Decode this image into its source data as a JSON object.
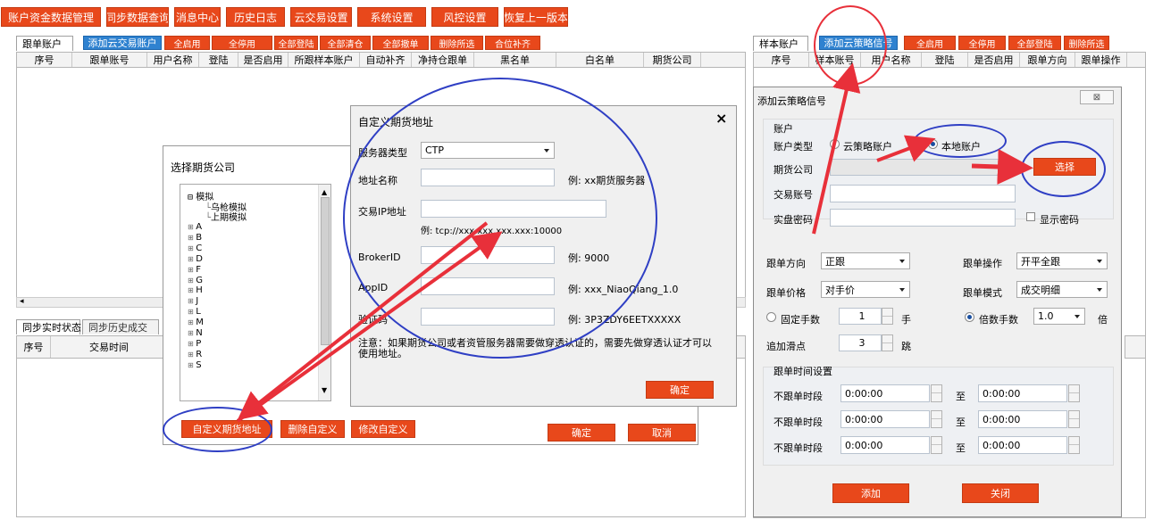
{
  "top_menu": [
    "账户资金数据管理",
    "同步数据查询",
    "消息中心",
    "历史日志",
    "云交易设置",
    "系统设置",
    "风控设置",
    "恢复上一版本"
  ],
  "left_tab": {
    "label": "跟单账户",
    "buttons_blue": "添加云交易账户",
    "buttons": [
      "全启用",
      "全停用",
      "全部登陆",
      "全部清仓",
      "全部撤单",
      "删除所选",
      "合位补齐"
    ]
  },
  "left_columns": [
    "序号",
    "跟单账号",
    "用户名称",
    "登陆",
    "是否启用",
    "所跟样本账户",
    "自动补齐",
    "净持仓跟单",
    "黑名单",
    "白名单",
    "期货公司"
  ],
  "bottom_tabs": [
    "同步实时状态",
    "同步历史成交"
  ],
  "bottom_columns": [
    "序号",
    "交易时间"
  ],
  "right_tab": {
    "label": "样本账户",
    "blue": "添加云策略信号",
    "buttons": [
      "全启用",
      "全停用",
      "全部登陆",
      "删除所选"
    ]
  },
  "right_columns": [
    "序号",
    "样本账号",
    "用户名称",
    "登陆",
    "是否启用",
    "跟单方向",
    "跟单操作"
  ],
  "company_dialog": {
    "title": "选择期货公司",
    "tree_root": "模拟",
    "tree_children": [
      "乌枪模拟",
      "上期模拟"
    ],
    "tree_letters": [
      "A",
      "B",
      "C",
      "D",
      "F",
      "G",
      "H",
      "J",
      "L",
      "M",
      "N",
      "P",
      "R",
      "S"
    ],
    "buttons": [
      "自定义期货地址",
      "删除自定义",
      "修改自定义"
    ],
    "ok": "确定",
    "cancel": "取消"
  },
  "custom_dialog": {
    "title": "自定义期货地址",
    "close": "×",
    "server_type_label": "服务器类型",
    "server_type_value": "CTP",
    "fields": [
      {
        "label": "地址名称",
        "example": "例: xx期货服务器"
      },
      {
        "label": "交易IP地址",
        "example": "例: tcp://xxx.xxx.xxx.xxx:10000"
      },
      {
        "label": "BrokerID",
        "example": "例: 9000"
      },
      {
        "label": "AppID",
        "example": "例: xxx_NiaoQiang_1.0"
      },
      {
        "label": "验证码",
        "example": "例: 3P3ZDY6EETXXXXX"
      }
    ],
    "note": "注意：如果期货公司或者资管服务器需要做穿透认证的，需要先做穿透认证才可以使用地址。",
    "ok": "确定"
  },
  "signal_dialog": {
    "title": "添加云策略信号",
    "close": "⊠",
    "account_group": "账户",
    "account_type_label": "账户类型",
    "account_type_options": [
      "云策略账户",
      "本地账户"
    ],
    "futures_company_label": "期货公司",
    "select_button": "选择",
    "trade_account_label": "交易账号",
    "password_label": "实盘密码",
    "show_password": "显示密码",
    "direction_label": "跟单方向",
    "direction_value": "正跟",
    "operation_label": "跟单操作",
    "operation_value": "开平全跟",
    "price_label": "跟单价格",
    "price_value": "对手价",
    "mode_label": "跟单模式",
    "mode_value": "成交明细",
    "fixed_lots_label": "固定手数",
    "fixed_lots_value": "1",
    "fixed_lots_unit": "手",
    "multiple_lots_label": "倍数手数",
    "multiple_lots_value": "1.0",
    "multiple_lots_unit": "倍",
    "slippage_label": "追加滑点",
    "slippage_value": "3",
    "slippage_unit": "跳",
    "time_group": "跟单时间设置",
    "time_rows": [
      {
        "label": "不跟单时段",
        "from": "0:00:00",
        "to_label": "至",
        "to": "0:00:00"
      },
      {
        "label": "不跟单时段",
        "from": "0:00:00",
        "to_label": "至",
        "to": "0:00:00"
      },
      {
        "label": "不跟单时段",
        "from": "0:00:00",
        "to_label": "至",
        "to": "0:00:00"
      }
    ],
    "add": "添加",
    "close_btn": "关闭"
  },
  "colors": {
    "orange": "#e8481b",
    "blue": "#2f82d0",
    "annotation_red": "#e8303a",
    "annotation_blue": "#2f3fc4"
  }
}
